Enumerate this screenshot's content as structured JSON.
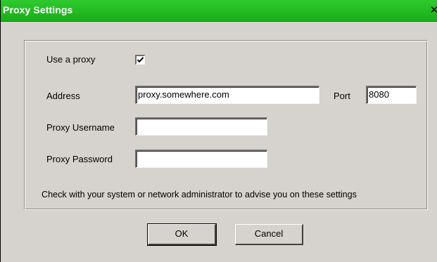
{
  "window": {
    "title": "Proxy Settings",
    "close_glyph": "✕"
  },
  "form": {
    "use_proxy_label": "Use a proxy",
    "use_proxy_checked": true,
    "address_label": "Address",
    "address_value": "proxy.somewhere.com",
    "port_label": "Port",
    "port_value": "8080",
    "username_label": "Proxy Username",
    "username_value": "",
    "password_label": "Proxy Password",
    "password_value": "",
    "hint": "Check with your system or network administrator to advise you on these settings"
  },
  "buttons": {
    "ok_label": "OK",
    "cancel_label": "Cancel"
  },
  "icons": {
    "close": "close-icon",
    "check": "checkmark-icon"
  },
  "colors": {
    "titlebar": "#19ad19",
    "dialog_bg": "#d6d3ce"
  }
}
